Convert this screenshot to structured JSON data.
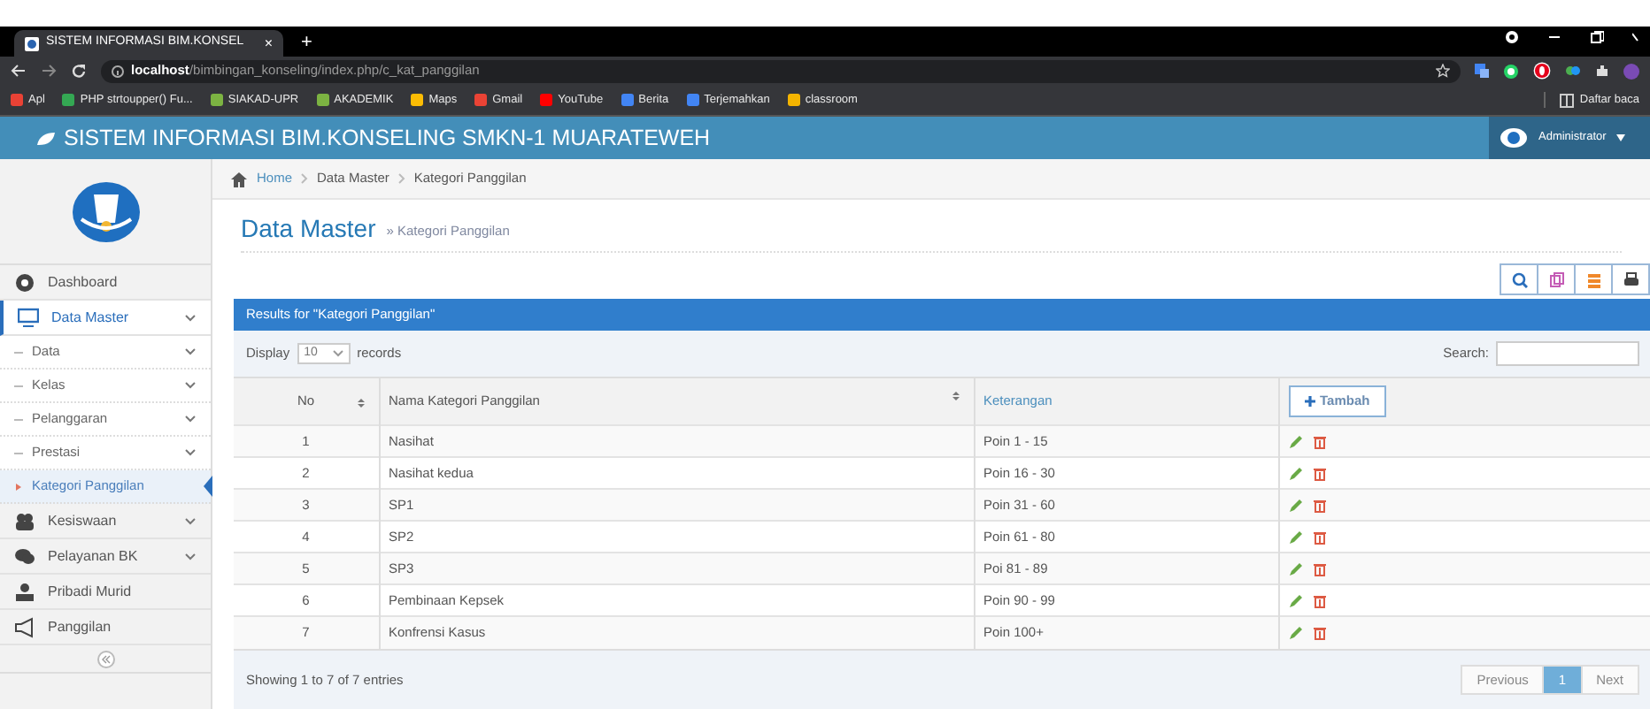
{
  "browser": {
    "tab_title": "SISTEM INFORMASI BIM.KONSEL",
    "tab_close": "×",
    "new_tab": "+",
    "url_host": "localhost",
    "url_path": "/bimbingan_konseling/index.php/c_kat_panggilan",
    "bookmarks": [
      {
        "label": "Apl",
        "color": "#e94235"
      },
      {
        "label": "PHP strtoupper() Fu...",
        "color": "#34a853"
      },
      {
        "label": "SIAKAD-UPR",
        "color": "#7cb342"
      },
      {
        "label": "AKADEMIK",
        "color": "#7cb342"
      },
      {
        "label": "Maps",
        "color": "#fbbc04"
      },
      {
        "label": "Gmail",
        "color": "#ea4335"
      },
      {
        "label": "YouTube",
        "color": "#ff0000"
      },
      {
        "label": "Berita",
        "color": "#4285f4"
      },
      {
        "label": "Terjemahkan",
        "color": "#4285f4"
      },
      {
        "label": "classroom",
        "color": "#f4b400"
      }
    ],
    "reading_list": "Daftar baca"
  },
  "app": {
    "title": "SISTEM INFORMASI BIM.KONSELING SMKN-1 MUARATEWEH",
    "user": "Administrator"
  },
  "sidebar": {
    "items": [
      {
        "label": "Dashboard",
        "submenu": false,
        "selected": false
      },
      {
        "label": "Data Master",
        "submenu": true,
        "selected": true,
        "children": [
          {
            "label": "Data",
            "submenu": true,
            "selected": false
          },
          {
            "label": "Kelas",
            "submenu": true,
            "selected": false
          },
          {
            "label": "Pelanggaran",
            "submenu": true,
            "selected": false
          },
          {
            "label": "Prestasi",
            "submenu": true,
            "selected": false
          },
          {
            "label": "Kategori Panggilan",
            "submenu": false,
            "selected": true
          }
        ]
      },
      {
        "label": "Kesiswaan",
        "submenu": true,
        "selected": false
      },
      {
        "label": "Pelayanan BK",
        "submenu": true,
        "selected": false
      },
      {
        "label": "Pribadi Murid",
        "submenu": false,
        "selected": false
      },
      {
        "label": "Panggilan",
        "submenu": false,
        "selected": false
      }
    ]
  },
  "breadcrumb": [
    "Home",
    "Data Master",
    "Kategori Panggilan"
  ],
  "page": {
    "title": "Data Master",
    "subtitle": "» Kategori Panggilan"
  },
  "panel": {
    "title": "Results for \"Kategori Panggilan\"",
    "display_label": "Display",
    "page_size": "10",
    "records_label": "records",
    "search_label": "Search:"
  },
  "table": {
    "columns": [
      "No",
      "Nama Kategori Panggilan",
      "Keterangan"
    ],
    "add_button": "Tambah",
    "rows": [
      [
        "1",
        "Nasihat",
        "Poin 1 - 15"
      ],
      [
        "2",
        "Nasihat kedua",
        "Poin 16 - 30"
      ],
      [
        "3",
        "SP1",
        "Poin 31 - 60"
      ],
      [
        "4",
        "SP2",
        "Poin 61 - 80"
      ],
      [
        "5",
        "SP3",
        "Poi 81 - 89"
      ],
      [
        "6",
        "Pembinaan Kepsek",
        "Poin 90 - 99"
      ],
      [
        "7",
        "Konfrensi Kasus",
        "Poin 100+"
      ]
    ]
  },
  "footer": {
    "info": "Showing 1 to 7 of 7 entries",
    "pages": [
      {
        "label": "Previous",
        "selected": false
      },
      {
        "label": "1",
        "selected": true
      },
      {
        "label": "Next",
        "selected": false
      }
    ]
  }
}
